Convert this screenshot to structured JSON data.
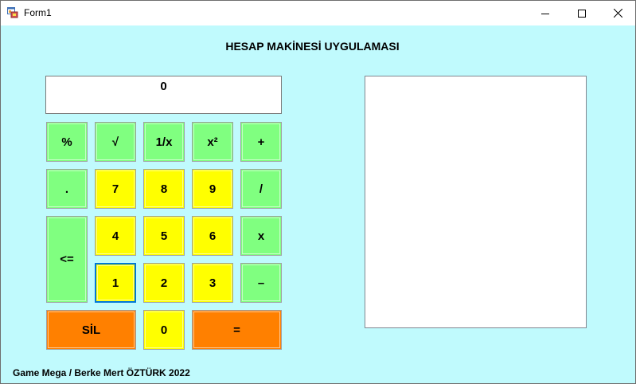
{
  "window": {
    "title": "Form1",
    "icon": "form-app-icon",
    "controls": [
      "minimize-icon",
      "maximize-icon",
      "close-icon"
    ]
  },
  "heading": "HESAP MAKİNESİ UYGULAMASI",
  "display": {
    "value": "0"
  },
  "keys": {
    "percent": "%",
    "sqrt": "√",
    "reciprocal": "1/x",
    "square": "x²",
    "plus": "+",
    "dot": ".",
    "seven": "7",
    "eight": "8",
    "nine": "9",
    "divide": "/",
    "backspace": "<=",
    "four": "4",
    "five": "5",
    "six": "6",
    "multiply": "x",
    "one": "1",
    "two": "2",
    "three": "3",
    "minus": "–",
    "clear": "SİL",
    "zero": "0",
    "equals": "="
  },
  "history": {
    "items": []
  },
  "footer": "Game Mega / Berke Mert ÖZTÜRK 2022",
  "colors": {
    "form_background": "#c0fafd",
    "operator_key": "#80ff80",
    "digit_key": "#ffff00",
    "action_key": "#ff8000",
    "focus_border": "#0078d7"
  }
}
